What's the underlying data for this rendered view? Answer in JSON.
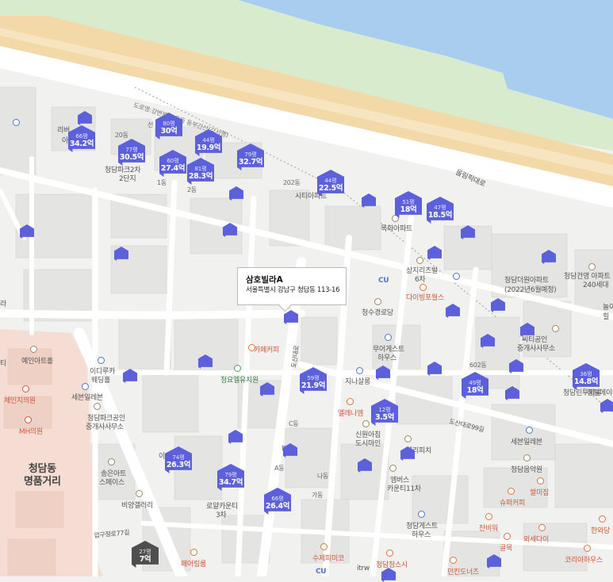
{
  "labels": {
    "expressway": "도로명:강변북로 운동 동부간선(강서행)",
    "olympic_road": "올림픽대로",
    "district": "청담동\n명품거리",
    "road_dosan": "도산대로",
    "road_dosan99": "도산대로99길",
    "road_apgujeong77": "압구정로77길"
  },
  "places": [
    {
      "name": "리버",
      "color": "normal"
    },
    {
      "name": "아",
      "color": "normal"
    },
    {
      "name": "20동",
      "color": "mid"
    },
    {
      "name": "청담파크2차",
      "color": "normal"
    },
    {
      "name": "2단지",
      "color": "normal"
    },
    {
      "name": "선",
      "color": "mid"
    },
    {
      "name": "1동",
      "color": "mid"
    },
    {
      "name": "2동",
      "color": "mid"
    },
    {
      "name": "202동",
      "color": "mid"
    },
    {
      "name": "시티아파트",
      "color": "normal"
    },
    {
      "name": "목화아파트",
      "color": "normal"
    },
    {
      "name": "상지리츠빌",
      "color": "normal"
    },
    {
      "name": "6차",
      "color": "normal"
    },
    {
      "name": "다이빙포월스",
      "color": "red"
    },
    {
      "name": "청수경로당",
      "color": "normal"
    },
    {
      "name": "청담더원아파트",
      "color": "normal"
    },
    {
      "name": "(2022년6월예정)",
      "color": "normal"
    },
    {
      "name": "청담건영 아파트",
      "color": "normal"
    },
    {
      "name": "240세대",
      "color": "normal"
    },
    {
      "name": "힐",
      "color": "normal"
    },
    {
      "name": "씨티공인",
      "color": "normal"
    },
    {
      "name": "중개사사무소",
      "color": "normal"
    },
    {
      "name": "무어게스트",
      "color": "normal"
    },
    {
      "name": "하우스",
      "color": "normal"
    },
    {
      "name": "카페커피",
      "color": "red"
    },
    {
      "name": "청요엘유치원",
      "color": "green"
    },
    {
      "name": "지나살롱",
      "color": "normal"
    },
    {
      "name": "예인아트홀",
      "color": "normal"
    },
    {
      "name": "이디루카",
      "color": "normal"
    },
    {
      "name": "웨딩홀",
      "color": "normal"
    },
    {
      "name": "세븐일레븐",
      "color": "normal"
    },
    {
      "name": "청담파크공인",
      "color": "normal"
    },
    {
      "name": "중개사사무소",
      "color": "normal"
    },
    {
      "name": "체인지의원",
      "color": "red"
    },
    {
      "name": "MH의원",
      "color": "red"
    },
    {
      "name": "엘레나엠",
      "color": "red"
    },
    {
      "name": "신원아침",
      "color": "normal"
    },
    {
      "name": "도시마인",
      "color": "normal"
    },
    {
      "name": "C동",
      "color": "mid"
    },
    {
      "name": "B동",
      "color": "mid"
    },
    {
      "name": "A동",
      "color": "mid"
    },
    {
      "name": "나동",
      "color": "mid"
    },
    {
      "name": "가동",
      "color": "mid"
    },
    {
      "name": "이",
      "color": "normal"
    },
    {
      "name": "송은아트",
      "color": "normal"
    },
    {
      "name": "스페이스",
      "color": "normal"
    },
    {
      "name": "비양갤러리",
      "color": "normal"
    },
    {
      "name": "로얄카운티",
      "color": "normal"
    },
    {
      "name": "3차",
      "color": "normal"
    },
    {
      "name": "엠버스",
      "color": "normal"
    },
    {
      "name": "카운티11차",
      "color": "normal"
    },
    {
      "name": "엘리피치",
      "color": "normal"
    },
    {
      "name": "청담에이티아트",
      "color": "normal"
    },
    {
      "name": "세븐일레븐",
      "color": "normal"
    },
    {
      "name": "청담음악원",
      "color": "normal"
    },
    {
      "name": "슈퍼커피",
      "color": "red"
    },
    {
      "name": "청담게스트",
      "color": "normal"
    },
    {
      "name": "하우스",
      "color": "normal"
    },
    {
      "name": "잔비워",
      "color": "red"
    },
    {
      "name": "외세다이",
      "color": "red"
    },
    {
      "name": "골목",
      "color": "red"
    },
    {
      "name": "한와당",
      "color": "red"
    },
    {
      "name": "코리아하우스",
      "color": "red"
    },
    {
      "name": "페어링룸",
      "color": "red"
    },
    {
      "name": "수제피미코",
      "color": "red"
    },
    {
      "name": "청담청스시",
      "color": "red"
    },
    {
      "name": "itrw",
      "color": "normal"
    },
    {
      "name": "던킨도너츠",
      "color": "red"
    },
    {
      "name": "602동",
      "color": "mid"
    },
    {
      "name": "쌀미집",
      "color": "red"
    },
    {
      "name": "청담린투지빌",
      "color": "normal"
    },
    {
      "name": "CU",
      "color": "blue"
    },
    {
      "name": "CU",
      "color": "blue"
    },
    {
      "name": "라",
      "color": "normal"
    },
    {
      "name": "놀이",
      "color": "normal"
    },
    {
      "name": "티",
      "color": "normal"
    }
  ],
  "listings": [
    {
      "area": "66평",
      "price": "34.2억"
    },
    {
      "area": "80평",
      "price": "30억"
    },
    {
      "area": "77평",
      "price": "30.5억"
    },
    {
      "area": "44평",
      "price": "19.9억"
    },
    {
      "area": "79평",
      "price": "32.7억"
    },
    {
      "area": "60평",
      "price": "27.4억"
    },
    {
      "area": "81평",
      "price": "28.3억"
    },
    {
      "area": "44평",
      "price": "22.5억"
    },
    {
      "area": "51평",
      "price": "18억"
    },
    {
      "area": "47평",
      "price": "18.5억"
    },
    {
      "area": "59평",
      "price": "21.9억"
    },
    {
      "area": "49평",
      "price": "18억"
    },
    {
      "area": "36평",
      "price": "14.8억"
    },
    {
      "area": "12평",
      "price": "3.5억"
    },
    {
      "area": "74평",
      "price": "26.3억"
    },
    {
      "area": "79평",
      "price": "34.7억"
    },
    {
      "area": "66평",
      "price": "26.4억"
    },
    {
      "area": "27평",
      "price": "7억"
    }
  ],
  "popup": {
    "name": "삼호빌라A",
    "address": "서울특별시 강남구 청담동 113-16"
  },
  "colors": {
    "water": "#a8cdef",
    "expressway": "#f3d8a8",
    "park": "#d8eccd",
    "marker": "#5c61db",
    "marker_dark": "#4e4e4e",
    "commercial": "#f6ddd3"
  }
}
